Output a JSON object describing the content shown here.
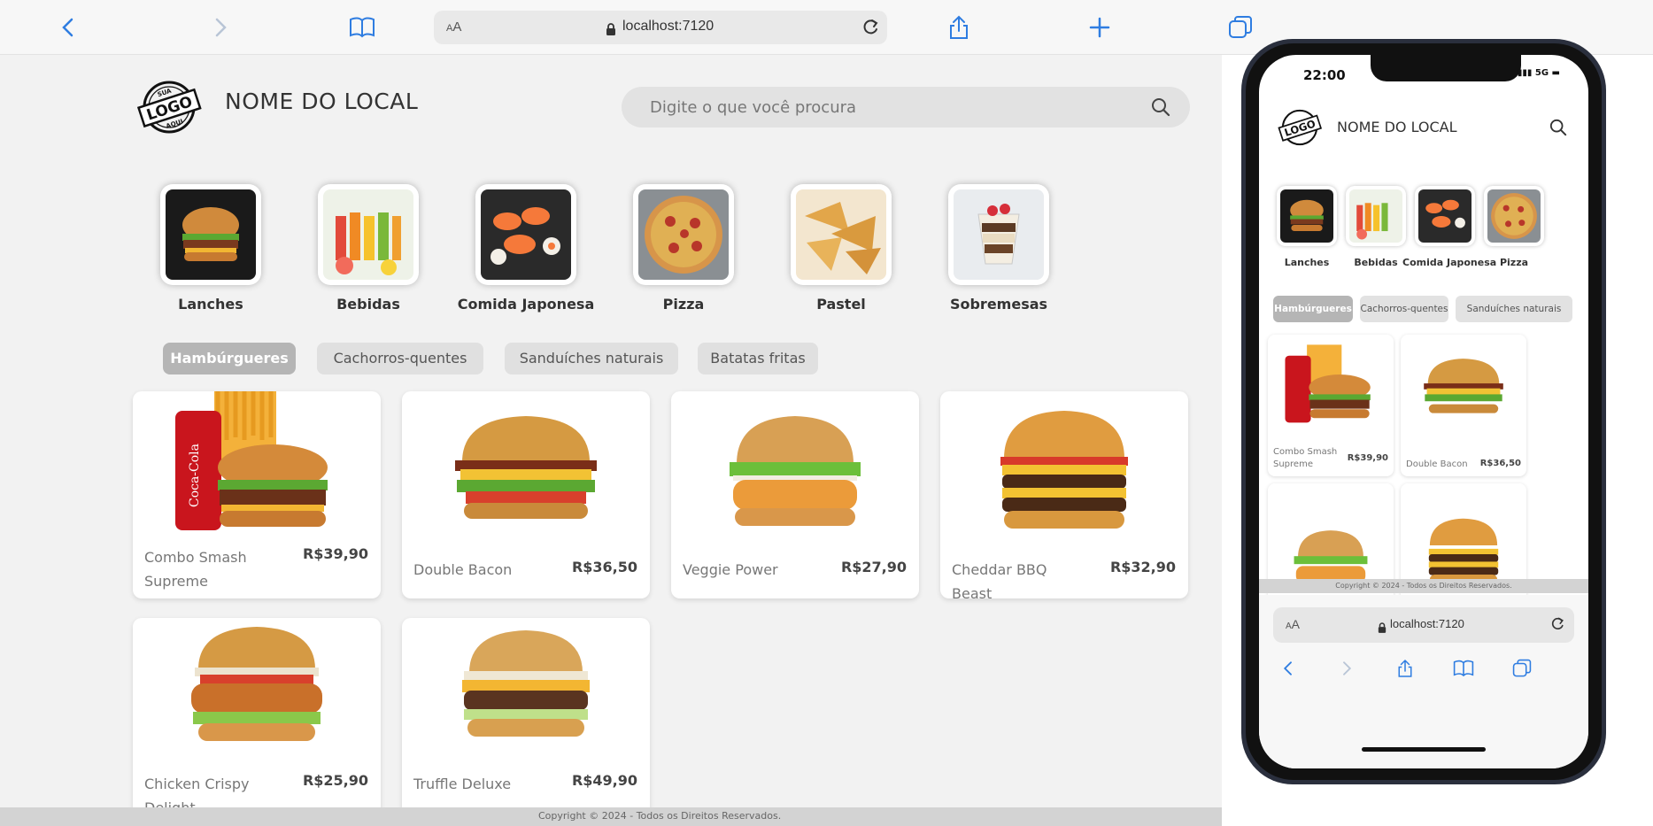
{
  "browser": {
    "url": "localhost:7120",
    "aa_small": "A",
    "aa_large": "A"
  },
  "site": {
    "title": "NOME DO LOCAL",
    "search_placeholder": "Digite o que você procura",
    "logo_text": [
      "SUA",
      "LOGO",
      "AQUI"
    ]
  },
  "categories": [
    {
      "label": "Lanches",
      "icon": "burger-image"
    },
    {
      "label": "Bebidas",
      "icon": "juices-image"
    },
    {
      "label": "Comida Japonesa",
      "icon": "sushi-image"
    },
    {
      "label": "Pizza",
      "icon": "pizza-image"
    },
    {
      "label": "Pastel",
      "icon": "pastel-image"
    },
    {
      "label": "Sobremesas",
      "icon": "dessert-image"
    }
  ],
  "subcategories": [
    {
      "label": "Hambúrgueres",
      "active": true
    },
    {
      "label": "Cachorros-quentes",
      "active": false
    },
    {
      "label": "Sanduíches naturais",
      "active": false
    },
    {
      "label": "Batatas fritas",
      "active": false
    }
  ],
  "products": [
    {
      "name": "Combo Smash Supreme",
      "price": "R$39,90"
    },
    {
      "name": "Double Bacon",
      "price": "R$36,50"
    },
    {
      "name": "Veggie Power",
      "price": "R$27,90"
    },
    {
      "name": "Cheddar BBQ Beast",
      "price": "R$32,90"
    },
    {
      "name": "Chicken Crispy Delight",
      "price": "R$25,90"
    },
    {
      "name": "Truffle Deluxe",
      "price": "R$49,90"
    }
  ],
  "footer": {
    "text": "Copyright © 2024 - Todos os Direitos Reservados."
  },
  "phone": {
    "time": "22:00",
    "network": "5G",
    "chips": [
      "Hambúrgueres",
      "Cachorros-quentes",
      "Sanduíches naturais"
    ],
    "categories": [
      "Lanches",
      "Bebidas",
      "Comida Japonesa",
      "Pizza"
    ]
  },
  "colors": {
    "accent_blue": "#3b82f6",
    "chip_active": "#b5b5b5",
    "page_bg": "#f2f2f2"
  }
}
